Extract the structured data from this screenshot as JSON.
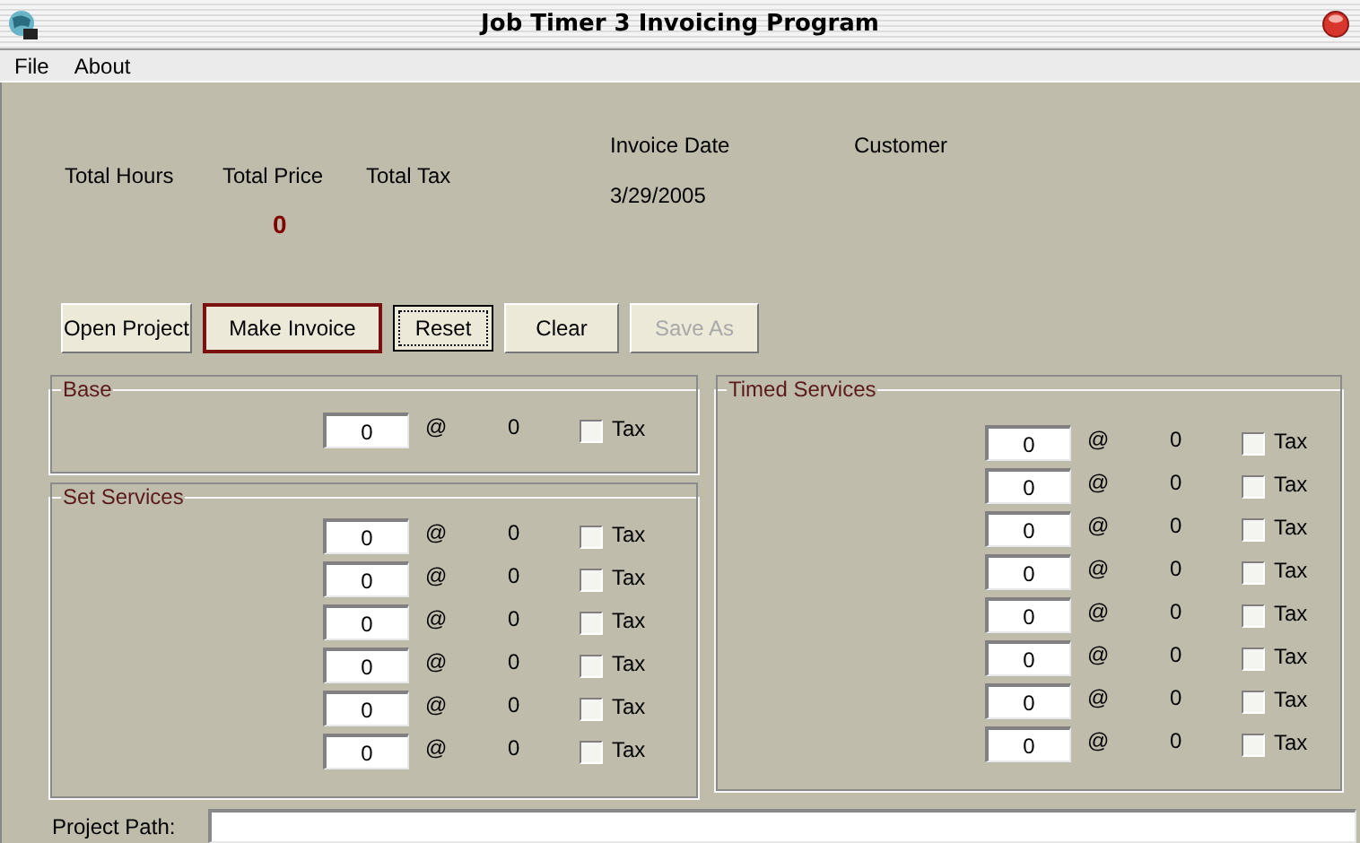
{
  "window": {
    "title": "Job Timer 3 Invoicing Program"
  },
  "menu": [
    "File",
    "About"
  ],
  "totals": [
    {
      "label": "Total Hours"
    },
    {
      "label": "Total Price",
      "value": "0"
    },
    {
      "label": "Total Tax"
    }
  ],
  "invoice_date": {
    "label": "Invoice Date",
    "value": "3/29/2005"
  },
  "customer": {
    "label": "Customer"
  },
  "buttons": [
    {
      "label": "Open Project",
      "kind": "normal",
      "disabled": false
    },
    {
      "label": "Make Invoice",
      "kind": "default",
      "disabled": false
    },
    {
      "label": "Reset",
      "kind": "focused",
      "disabled": false
    },
    {
      "label": "Clear",
      "kind": "normal",
      "disabled": false
    },
    {
      "label": "Save As",
      "kind": "normal",
      "disabled": true
    }
  ],
  "groups": [
    {
      "title": "Base",
      "rows": [
        {
          "quantity": "0",
          "at": "@",
          "rate": "0",
          "tax_label": "Tax",
          "checked": false
        }
      ]
    },
    {
      "title": "Set Services",
      "rows": [
        {
          "quantity": "0",
          "at": "@",
          "rate": "0",
          "tax_label": "Tax",
          "checked": false
        },
        {
          "quantity": "0",
          "at": "@",
          "rate": "0",
          "tax_label": "Tax",
          "checked": false
        },
        {
          "quantity": "0",
          "at": "@",
          "rate": "0",
          "tax_label": "Tax",
          "checked": false
        },
        {
          "quantity": "0",
          "at": "@",
          "rate": "0",
          "tax_label": "Tax",
          "checked": false
        },
        {
          "quantity": "0",
          "at": "@",
          "rate": "0",
          "tax_label": "Tax",
          "checked": false
        },
        {
          "quantity": "0",
          "at": "@",
          "rate": "0",
          "tax_label": "Tax",
          "checked": false
        }
      ]
    },
    {
      "title": "Timed Services",
      "rows": [
        {
          "quantity": "0",
          "at": "@",
          "rate": "0",
          "tax_label": "Tax",
          "checked": false
        },
        {
          "quantity": "0",
          "at": "@",
          "rate": "0",
          "tax_label": "Tax",
          "checked": false
        },
        {
          "quantity": "0",
          "at": "@",
          "rate": "0",
          "tax_label": "Tax",
          "checked": false
        },
        {
          "quantity": "0",
          "at": "@",
          "rate": "0",
          "tax_label": "Tax",
          "checked": false
        },
        {
          "quantity": "0",
          "at": "@",
          "rate": "0",
          "tax_label": "Tax",
          "checked": false
        },
        {
          "quantity": "0",
          "at": "@",
          "rate": "0",
          "tax_label": "Tax",
          "checked": false
        },
        {
          "quantity": "0",
          "at": "@",
          "rate": "0",
          "tax_label": "Tax",
          "checked": false
        },
        {
          "quantity": "0",
          "at": "@",
          "rate": "0",
          "tax_label": "Tax",
          "checked": false
        }
      ]
    }
  ],
  "project_path": {
    "label": "Project Path:"
  }
}
